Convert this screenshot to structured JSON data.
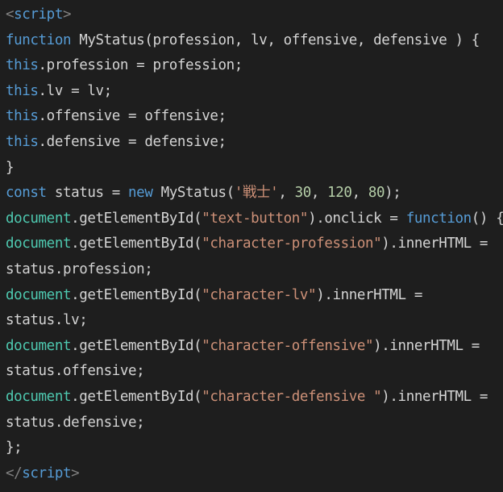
{
  "code": {
    "open_tag": {
      "lt": "<",
      "name": "script",
      "gt": ">"
    },
    "line2": {
      "kw": "function",
      "rest": " MyStatus(profession, lv, offensive, defensive ) {"
    },
    "line3": {
      "kw": "this",
      "rest": ".profession = profession;"
    },
    "line4": {
      "kw": "this",
      "rest": ".lv = lv;"
    },
    "line5": {
      "kw": "this",
      "rest": ".offensive = offensive;"
    },
    "line6": {
      "kw": "this",
      "rest": ".defensive = defensive;"
    },
    "line7": {
      "text": "}"
    },
    "line8": {
      "kw": "const",
      "mid": " status = ",
      "kw2": "new",
      "call": " MyStatus(",
      "str": "'戦士'",
      "sep1": ", ",
      "n1": "30",
      "sep2": ", ",
      "n2": "120",
      "sep3": ", ",
      "n3": "80",
      "end": ");"
    },
    "line9": {
      "obj": "document",
      "call": ".getElementById(",
      "str": "\"text-button\"",
      "mid": ").onclick = ",
      "kw": "function",
      "end": "() {"
    },
    "line10": {
      "obj": "document",
      "call": ".getElementById(",
      "str": "\"character-profession\"",
      "end": ").innerHTML ="
    },
    "line11": {
      "text": "status.profession;"
    },
    "line12": {
      "obj": "document",
      "call": ".getElementById(",
      "str": "\"character-lv\"",
      "end": ").innerHTML ="
    },
    "line13": {
      "text": "status.lv;"
    },
    "line14": {
      "obj": "document",
      "call": ".getElementById(",
      "str": "\"character-offensive\"",
      "end": ").innerHTML ="
    },
    "line15": {
      "text": "status.offensive;"
    },
    "line16": {
      "obj": "document",
      "call": ".getElementById(",
      "str": "\"character-defensive \"",
      "end": ").innerHTML ="
    },
    "line17": {
      "text": "status.defensive;"
    },
    "line18": {
      "text": "};"
    },
    "close_tag": {
      "lt": "</",
      "name": "script",
      "gt": ">"
    }
  },
  "colors": {
    "background": "#1e1e1e",
    "default_text": "#d4d4d4",
    "keyword": "#569cd6",
    "tag_bracket": "#808080",
    "string": "#ce9178",
    "number": "#b5cea8",
    "object": "#4ec9b0"
  }
}
